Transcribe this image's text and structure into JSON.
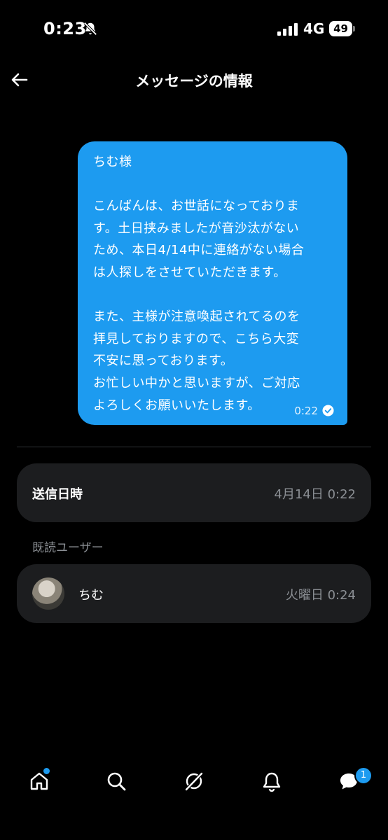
{
  "status_bar": {
    "time": "0:23",
    "network": "4G",
    "battery": "49"
  },
  "header": {
    "title": "メッセージの情報"
  },
  "message": {
    "text": "ちむ様\n\nこんばんは、お世話になっておりま\nす。土日挟みましたが音沙汰がない\nため、本日4/14中に連絡がない場合\nは人探しをさせていただきます。\n\nまた、主様が注意喚起されてるのを\n拝見しておりますので、こちら大変\n不安に思っております。\nお忙しい中かと思いますが、ご対応\nよろしくお願いいたします。",
    "time": "0:22",
    "bubble_color": "#1d9bf0"
  },
  "sent_info": {
    "label": "送信日時",
    "value": "4月14日 0:22"
  },
  "readers": {
    "section_label": "既読ユーザー",
    "items": [
      {
        "name": "ちむ",
        "time": "火曜日 0:24"
      }
    ]
  },
  "tab_bar": {
    "tabs": [
      "home-icon",
      "search-icon",
      "grok-icon",
      "notifications-icon",
      "messages-icon"
    ],
    "messages_badge": "1",
    "accent": "#1d9bf0"
  }
}
